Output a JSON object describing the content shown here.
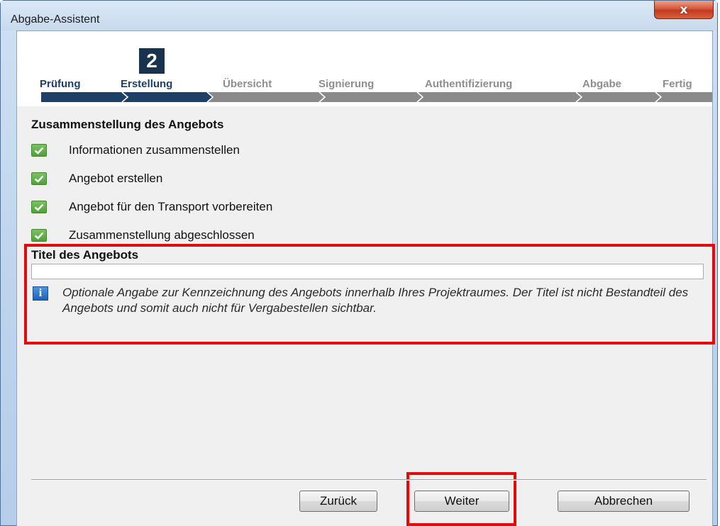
{
  "window": {
    "title": "Abgabe-Assistent",
    "close_label": "x"
  },
  "wizard": {
    "current_step_number": "2",
    "steps": [
      {
        "label": "Prüfung",
        "state": "done"
      },
      {
        "label": "Erstellung",
        "state": "current"
      },
      {
        "label": "Übersicht",
        "state": "pending"
      },
      {
        "label": "Signierung",
        "state": "pending"
      },
      {
        "label": "Authentifizierung",
        "state": "pending"
      },
      {
        "label": "Abgabe",
        "state": "pending"
      },
      {
        "label": "Fertig",
        "state": "pending"
      }
    ],
    "completed_color": "#1e3f66",
    "pending_color": "#8e8e8e"
  },
  "main": {
    "section_title": "Zusammenstellung des Angebots",
    "tasks": [
      {
        "label": "Informationen zusammenstellen",
        "icon": "check-icon",
        "done": true
      },
      {
        "label": "Angebot erstellen",
        "icon": "check-icon",
        "done": true
      },
      {
        "label": "Angebot für den Transport vorbereiten",
        "icon": "check-icon",
        "done": true
      },
      {
        "label": "Zusammenstellung abgeschlossen",
        "icon": "check-icon",
        "done": true
      }
    ],
    "title_field": {
      "label": "Titel des Angebots",
      "value": "",
      "info_icon": "info-icon",
      "info_text": "Optionale Angabe zur Kennzeichnung des Angebots innerhalb Ihres Projektraumes. Der Titel ist nicht Bestandteil des Angebots und somit auch nicht für Vergabestellen sichtbar."
    }
  },
  "footer": {
    "back_label": "Zurück",
    "next_label": "Weiter",
    "cancel_label": "Abbrechen"
  },
  "colors": {
    "highlight": "#e4090b",
    "check": "#4ea236",
    "step_badge": "#19324d"
  }
}
